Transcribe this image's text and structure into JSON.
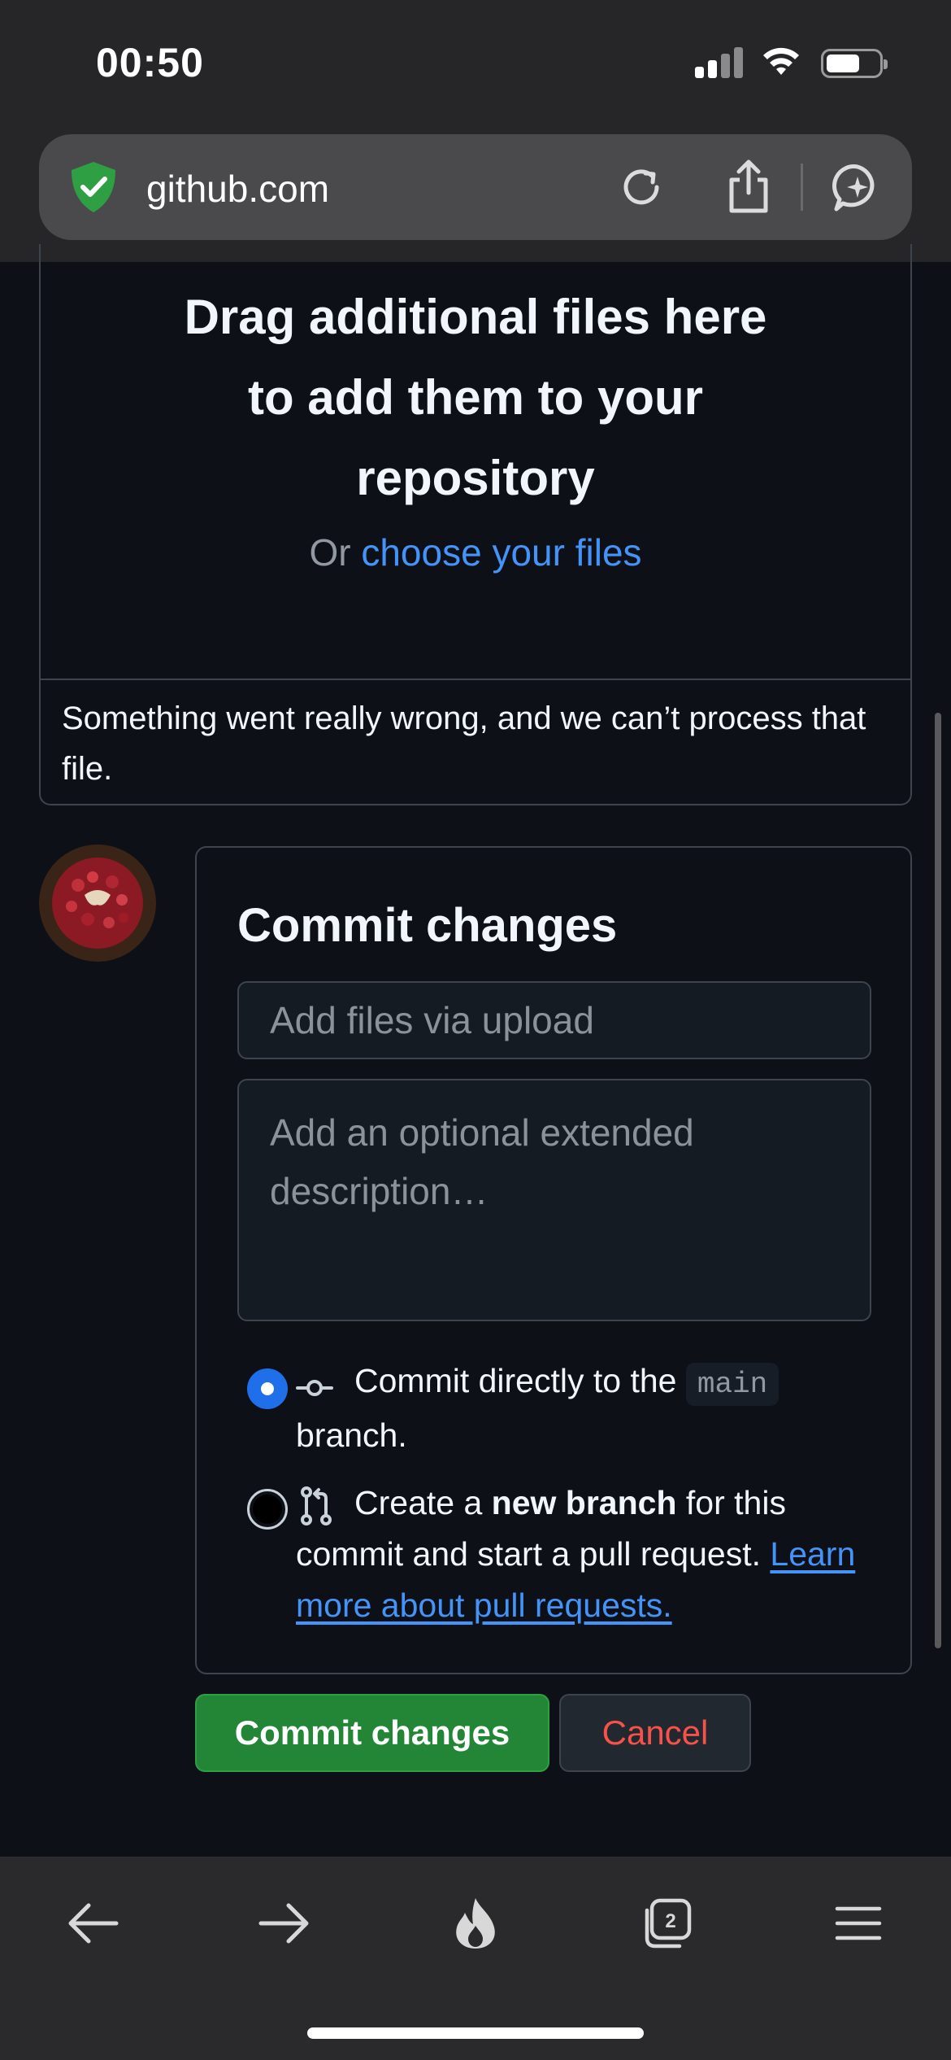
{
  "status_bar": {
    "time": "00:50"
  },
  "browser": {
    "address": "github.com",
    "open_tabs_count": "2"
  },
  "dropzone": {
    "title": "Drag additional files here to add them to your repository",
    "or_text": "Or",
    "choose_link": "choose your files",
    "error_message": "Something went really wrong, and we can’t process that file."
  },
  "commit": {
    "title": "Commit changes",
    "summary_placeholder": "Add files via upload",
    "description_placeholder": "Add an optional extended description…",
    "option_direct": {
      "prefix": "Commit directly to the",
      "branch_name": "main",
      "suffix": "branch.",
      "selected": true
    },
    "option_new_branch": {
      "prefix": "Create a",
      "bold": "new branch",
      "suffix": "for this commit and start a pull request.",
      "link": "Learn more about pull requests.",
      "selected": false
    },
    "commit_button": "Commit changes",
    "cancel_button": "Cancel"
  },
  "colors": {
    "background": "#0d1117",
    "link": "#4493f8",
    "primary_button": "#238636",
    "danger_text": "#f85149",
    "radio_selected": "#1f6feb"
  },
  "icons": {
    "address_security": "shield-check-icon",
    "reload": "reload-icon",
    "share": "share-icon",
    "assistant": "ai-sparkle-icon",
    "commit": "git-commit-icon",
    "branch": "git-pull-request-icon",
    "toolbar": [
      "back-arrow-icon",
      "forward-arrow-icon",
      "fire-icon",
      "tabs-icon",
      "menu-icon"
    ]
  }
}
